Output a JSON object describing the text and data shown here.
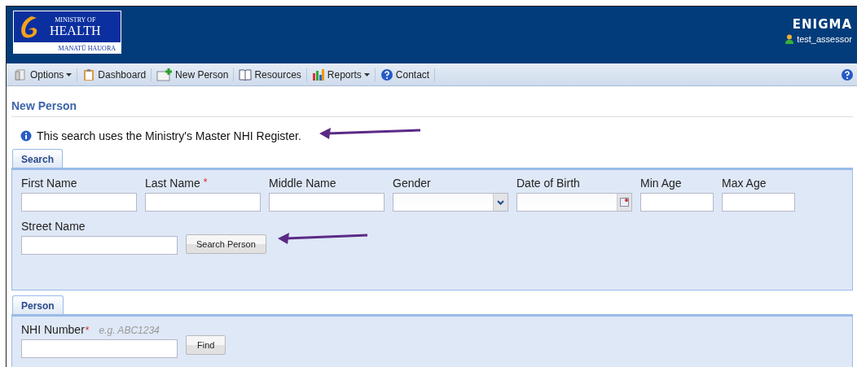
{
  "header": {
    "logo": {
      "line_1": "MINISTRY OF",
      "line_2": "HEALTH",
      "line_3": "MANATŪ HAUORA"
    },
    "brand": "ENIGMA",
    "user": "test_assessor"
  },
  "toolbar": [
    {
      "label": "Options",
      "kind": "options",
      "dropdown": true
    },
    {
      "label": "Dashboard",
      "kind": "dashboard",
      "dropdown": false
    },
    {
      "label": "New Person",
      "kind": "new-person",
      "dropdown": false
    },
    {
      "label": "Resources",
      "kind": "resources",
      "dropdown": false
    },
    {
      "label": "Reports",
      "kind": "reports",
      "dropdown": true
    },
    {
      "label": "Contact",
      "kind": "contact",
      "dropdown": false
    }
  ],
  "page_title": "New Person",
  "info": "This search uses the Ministry's Master NHI Register.",
  "search_panel": {
    "tab": "Search",
    "fields": [
      {
        "label": "First Name",
        "kind": "text"
      },
      {
        "label": "Last Name",
        "kind": "text",
        "required_mark": "*"
      },
      {
        "label": "Middle Name",
        "kind": "text"
      },
      {
        "label": "Gender",
        "kind": "select"
      },
      {
        "label": "Date of Birth",
        "kind": "date"
      },
      {
        "label": "Min Age",
        "kind": "number"
      },
      {
        "label": "Max Age",
        "kind": "number"
      }
    ],
    "street_label": "Street Name",
    "button": "Search Person"
  },
  "person_panel": {
    "tab": "Person",
    "label": "NHI Number",
    "required_mark": "*",
    "hint": "e.g. ABC1234",
    "button": "Find"
  }
}
